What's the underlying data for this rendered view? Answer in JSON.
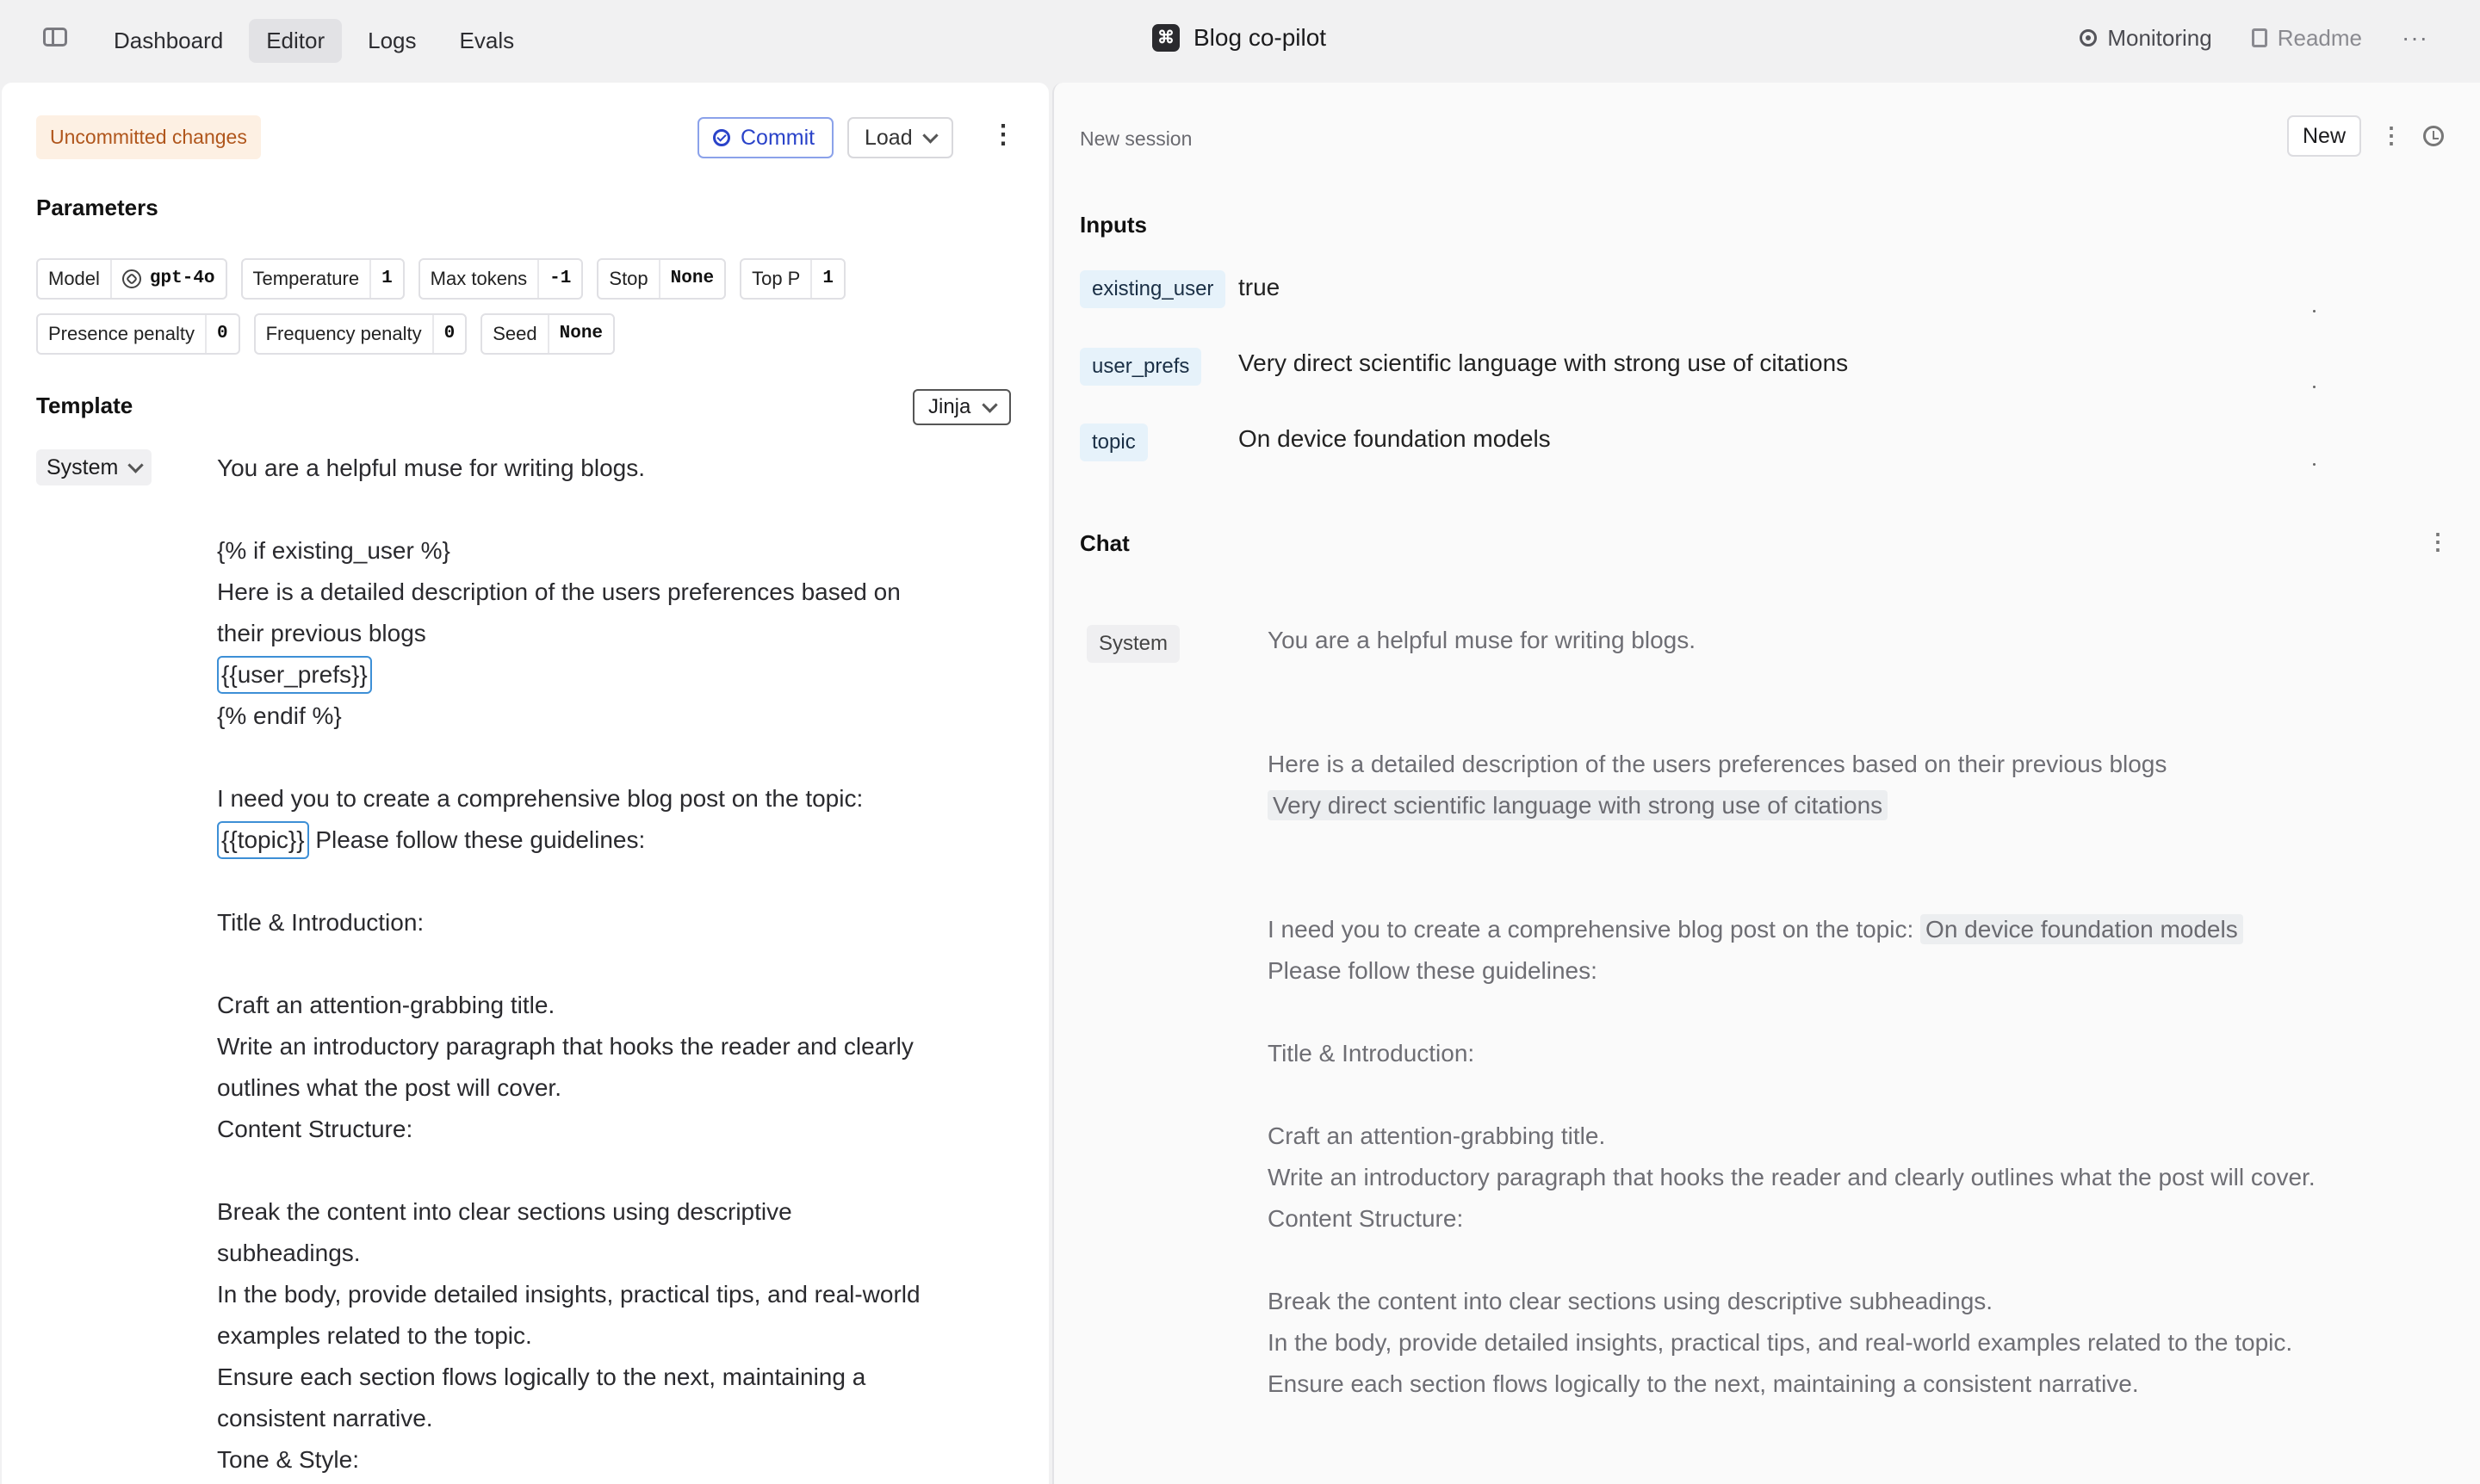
{
  "topbar": {
    "tabs": [
      {
        "label": "Dashboard",
        "active": false
      },
      {
        "label": "Editor",
        "active": true
      },
      {
        "label": "Logs",
        "active": false
      },
      {
        "label": "Evals",
        "active": false
      }
    ],
    "app_title": "Blog co-pilot",
    "monitoring_label": "Monitoring",
    "readme_label": "Readme"
  },
  "editor": {
    "status_badge": "Uncommitted changes",
    "commit_label": "Commit",
    "load_label": "Load",
    "parameters_title": "Parameters",
    "params": {
      "model": {
        "label": "Model",
        "value": "gpt-4o"
      },
      "temperature": {
        "label": "Temperature",
        "value": "1"
      },
      "max_tokens": {
        "label": "Max tokens",
        "value": "-1"
      },
      "stop": {
        "label": "Stop",
        "value": "None"
      },
      "top_p": {
        "label": "Top P",
        "value": "1"
      },
      "presence_penalty": {
        "label": "Presence penalty",
        "value": "0"
      },
      "frequency_penalty": {
        "label": "Frequency penalty",
        "value": "0"
      },
      "seed": {
        "label": "Seed",
        "value": "None"
      }
    },
    "template_title": "Template",
    "template_engine": "Jinja",
    "role": "System",
    "template": {
      "l1": "You are a helpful muse for writing blogs.",
      "l2": "{% if existing_user %}",
      "l3": "Here is a detailed description of the users preferences based on their previous blogs",
      "var_user_prefs": "{{user_prefs}}",
      "l4": "{% endif %}",
      "l5": "I need you to create a comprehensive blog post on the topic:",
      "var_topic": "{{topic}}",
      "l5b": " Please follow these guidelines:",
      "l6": "Title & Introduction:",
      "l7": "Craft an attention-grabbing title.",
      "l8": "Write an introductory paragraph that hooks the reader and clearly outlines what the post will cover.",
      "l9": "Content Structure:",
      "l10": "Break the content into clear sections using descriptive subheadings.",
      "l11": "In the body, provide detailed insights, practical tips, and real-world examples related to the topic.",
      "l12": "Ensure each section flows logically to the next, maintaining a consistent narrative.",
      "l13": "Tone & Style:"
    }
  },
  "session": {
    "title": "New session",
    "new_label": "New",
    "inputs_title": "Inputs",
    "inputs": [
      {
        "key": "existing_user",
        "value": "true"
      },
      {
        "key": "user_prefs",
        "value": "Very direct scientific language with strong use of citations"
      },
      {
        "key": "topic",
        "value": "On device foundation models"
      }
    ],
    "chat_title": "Chat",
    "chat_role": "System",
    "chat": {
      "l1": "You are a helpful muse for writing blogs.",
      "l2": "Here is a detailed description of the users preferences based on their previous blogs",
      "prefs": "Very direct scientific language with strong use of citations",
      "l3": "I need you to create a comprehensive blog post on the topic:",
      "topic": "On device foundation models",
      "l3b": "Please follow these guidelines:",
      "l4": "Title & Introduction:",
      "l5": "Craft an attention-grabbing title.",
      "l6": "Write an introductory paragraph that hooks the reader and clearly outlines what the post will cover.",
      "l7": "Content Structure:",
      "l8": "Break the content into clear sections using descriptive subheadings.",
      "l9": "In the body, provide detailed insights, practical tips, and real-world examples related to the topic.",
      "l10": "Ensure each section flows logically to the next, maintaining a consistent narrative."
    }
  }
}
